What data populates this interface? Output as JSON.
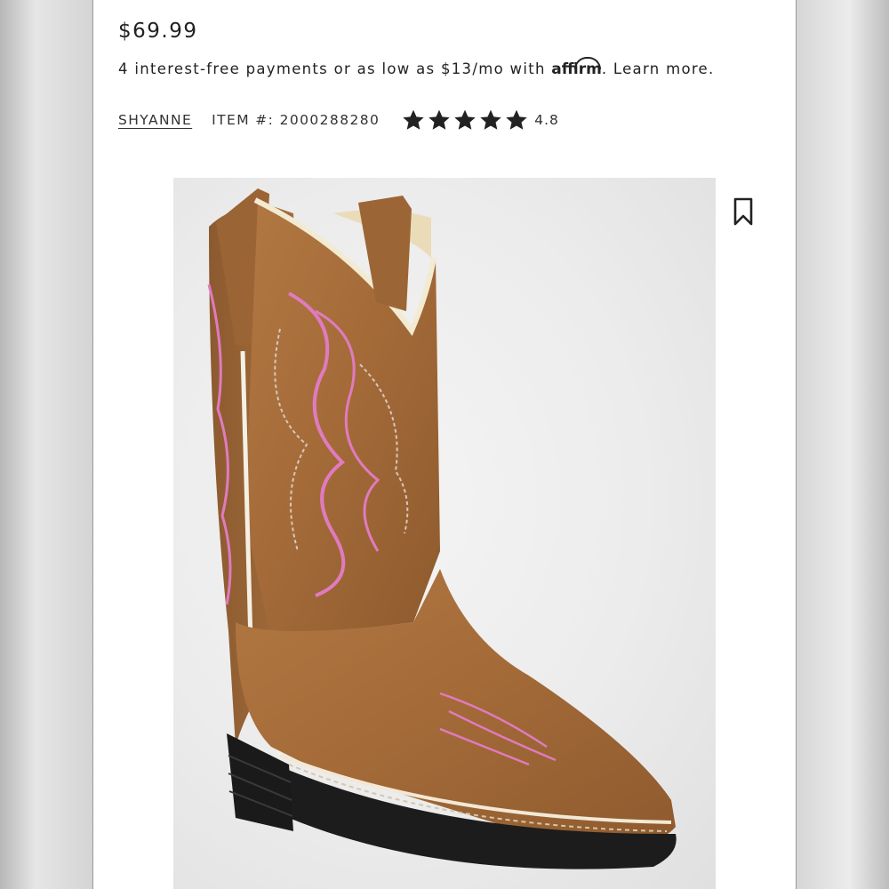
{
  "product": {
    "price": "$69.99",
    "payments": {
      "prefix": "4 interest-free payments or as low as $13/mo with ",
      "affirm_brand": "affirm",
      "suffix": ".",
      "learn_more": "Learn more."
    },
    "brand": "SHYANNE",
    "item_number": "ITEM #: 2000288280",
    "rating": "4.8",
    "rating_value": 4.8,
    "rating_max": 5
  },
  "icons": {
    "star": "star-icon",
    "bookmark": "bookmark-icon"
  },
  "colors": {
    "text": "#222222",
    "leather": "#a86d3c",
    "stitch_pink": "#e07bbf",
    "sole": "#1a1a1a"
  }
}
